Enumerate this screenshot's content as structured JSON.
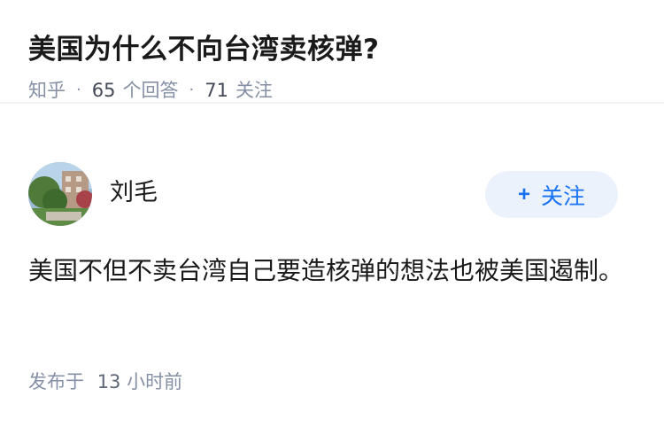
{
  "question": {
    "title": "美国为什么不向台湾卖核弹?",
    "source": "知乎",
    "answer_count": "65",
    "answer_label": "个回答",
    "follow_count": "71",
    "follow_label": "关注"
  },
  "answer": {
    "author": "刘毛",
    "follow_button": "关注",
    "follow_icon": "plus-icon",
    "content": "美国不但不卖台湾自己要造核弹的想法也被美国遏制。",
    "time_prefix": "发布于",
    "time_num": "13",
    "time_suffix": "小时前"
  },
  "colors": {
    "accent": "#1772f6",
    "follow_bg": "#ebf2fb",
    "meta": "#8590a6"
  }
}
